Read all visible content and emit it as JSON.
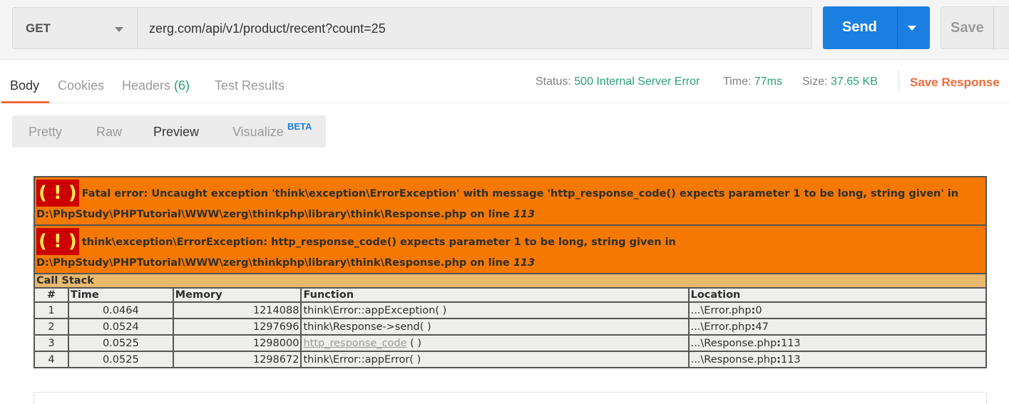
{
  "request": {
    "method": "GET",
    "url": "zerg.com/api/v1/product/recent?count=25",
    "send_label": "Send",
    "save_label": "Save"
  },
  "response": {
    "tabs": [
      {
        "label": "Body",
        "active": true
      },
      {
        "label": "Cookies"
      },
      {
        "label": "Headers ",
        "count": "(6)"
      },
      {
        "label": "Test Results"
      }
    ],
    "status_key": "Status:",
    "status_val": "500 Internal Server Error",
    "time_key": "Time:",
    "time_val": "77ms",
    "size_key": "Size:",
    "size_val": "37.65 KB",
    "save_response": "Save Response"
  },
  "views": {
    "items": [
      "Pretty",
      "Raw",
      "Preview",
      "Visualize"
    ],
    "active": "Preview",
    "beta": "BETA"
  },
  "error": {
    "bang": "( ! )",
    "fatal_text": "Fatal error: Uncaught exception 'think\\exception\\ErrorException' with message 'http_response_code() expects parameter 1 to be long, string given' in D:\\PhpStudy\\PHPTutorial\\WWW\\zerg\\thinkphp\\library\\think\\Response.php on line ",
    "fatal_line": "113",
    "exception_text": "think\\exception\\ErrorException: http_response_code() expects parameter 1 to be long, string given in D:\\PhpStudy\\PHPTutorial\\WWW\\zerg\\thinkphp\\library\\think\\Response.php on line ",
    "exception_line": "113",
    "callstack_title": "Call Stack",
    "columns": [
      "#",
      "Time",
      "Memory",
      "Function",
      "Location"
    ],
    "rows": [
      {
        "num": "1",
        "time": "0.0464",
        "memory": "1214088",
        "function": "think\\Error::appException( )",
        "loc_prefix": "...\\Error.php",
        "loc_sep": ":",
        "loc_line": "0"
      },
      {
        "num": "2",
        "time": "0.0524",
        "memory": "1297696",
        "function": "think\\Response->send( )",
        "loc_prefix": "...\\Error.php",
        "loc_sep": ":",
        "loc_line": "47"
      },
      {
        "num": "3",
        "time": "0.0525",
        "memory": "1298000",
        "function_link": "http_response_code",
        "function_suffix": " ( )",
        "loc_prefix": "...\\Response.php",
        "loc_sep": ":",
        "loc_line": "113"
      },
      {
        "num": "4",
        "time": "0.0525",
        "memory": "1298672",
        "function": "think\\Error::appError( )",
        "loc_prefix": "...\\Response.php",
        "loc_sep": ":",
        "loc_line": "113"
      }
    ]
  },
  "colors": {
    "accent_blue": "#1a7fe0",
    "accent_orange": "#f26b3a",
    "status_green": "#2aa079",
    "error_orange": "#f57900",
    "error_red": "#cc0000"
  }
}
